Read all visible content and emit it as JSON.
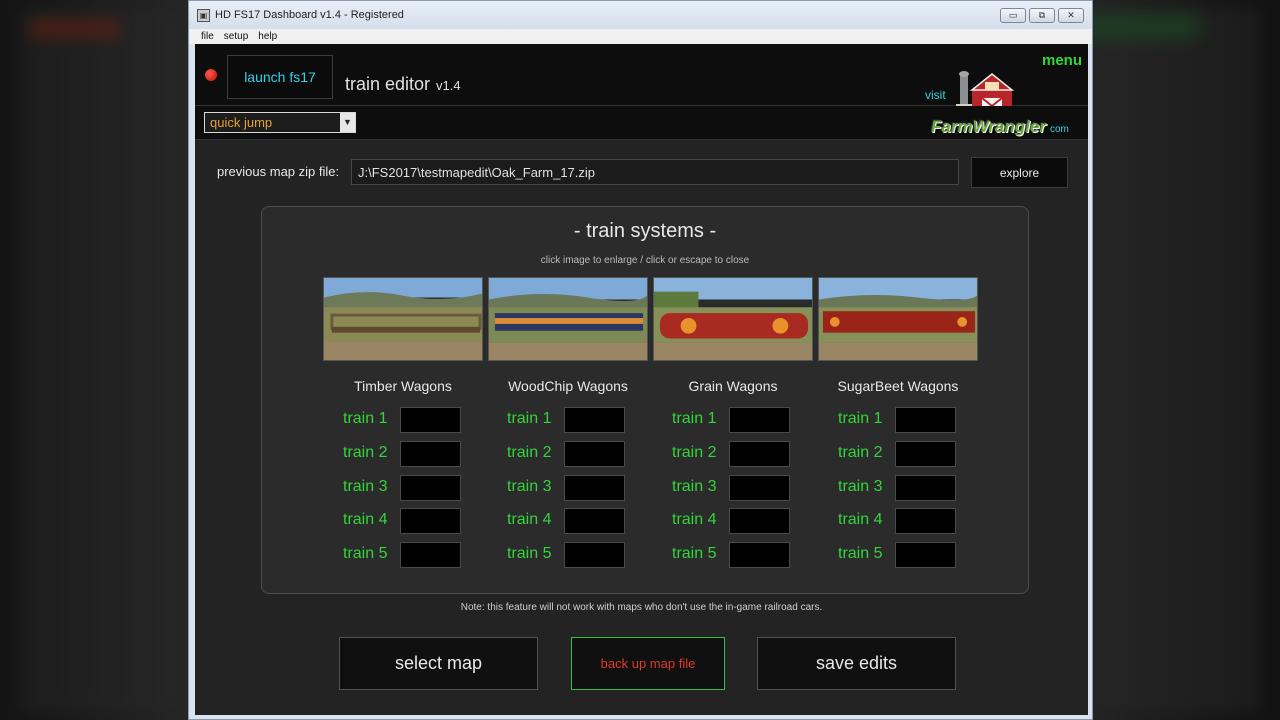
{
  "window": {
    "title": "HD FS17 Dashboard v1.4 - Registered",
    "menu": [
      "file",
      "setup",
      "help"
    ]
  },
  "header": {
    "launch_label": "launch fs17",
    "editor_title": "train editor",
    "editor_version": "v1.4",
    "menu_label": "menu",
    "visit_label": "visit",
    "logo_text": "FarmWrangler",
    "logo_suffix": "com"
  },
  "quickjump": {
    "value": "quick jump"
  },
  "prev_map": {
    "label": "previous map zip file:",
    "value": "J:\\FS2017\\testmapedit\\Oak_Farm_17.zip",
    "explore_label": "explore"
  },
  "panel": {
    "title": "-  train systems  -",
    "hint": "click image to enlarge / click or escape to close",
    "columns": [
      {
        "title": "Timber Wagons",
        "trains": [
          "train 1",
          "train 2",
          "train 3",
          "train 4",
          "train 5"
        ]
      },
      {
        "title": "WoodChip Wagons",
        "trains": [
          "train 1",
          "train 2",
          "train 3",
          "train 4",
          "train 5"
        ]
      },
      {
        "title": "Grain Wagons",
        "trains": [
          "train 1",
          "train 2",
          "train 3",
          "train 4",
          "train 5"
        ]
      },
      {
        "title": "SugarBeet Wagons",
        "trains": [
          "train 1",
          "train 2",
          "train 3",
          "train 4",
          "train 5"
        ]
      }
    ]
  },
  "note": "Note: this feature will not work with maps who don't use the in-game railroad cars.",
  "buttons": {
    "select_map": "select map",
    "back_up": "back up map file",
    "save_edits": "save edits"
  },
  "colors": {
    "accent_green": "#33d43a",
    "accent_cyan": "#2fd3e8",
    "warning_red": "#e03a2a",
    "quickjump_orange": "#e7a12f"
  }
}
